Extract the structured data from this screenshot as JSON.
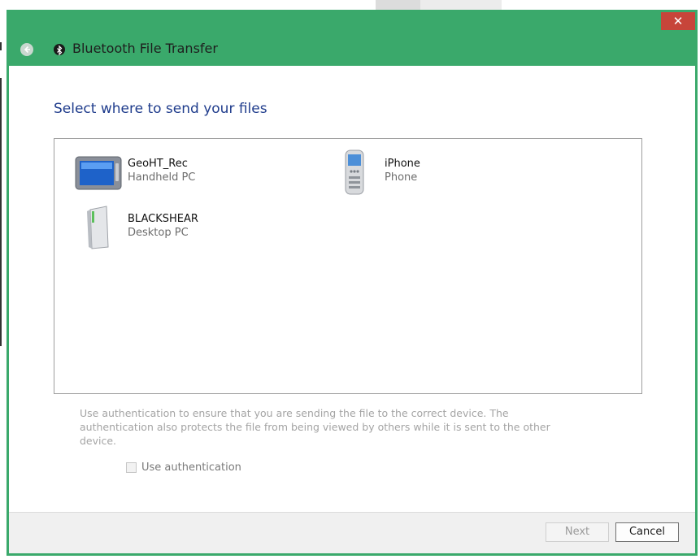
{
  "window": {
    "title": "Bluetooth File Transfer",
    "close_glyph": "✕"
  },
  "main": {
    "heading": "Select where to send your files"
  },
  "devices": [
    {
      "name": "GeoHT_Rec",
      "type": "Handheld PC",
      "icon": "handheld-pc-icon"
    },
    {
      "name": "iPhone",
      "type": "Phone",
      "icon": "phone-icon"
    },
    {
      "name": "BLACKSHEAR",
      "type": "Desktop PC",
      "icon": "desktop-pc-icon"
    }
  ],
  "auth": {
    "description": "Use authentication to ensure that you are sending the file to the correct device. The authentication also protects the file from being viewed by others while it is sent to the other device.",
    "checkbox_label": "Use authentication",
    "checked": false
  },
  "buttons": {
    "next": "Next",
    "cancel": "Cancel"
  },
  "colors": {
    "accent": "#3aa96b",
    "close": "#c7453a",
    "heading": "#1f3c8c"
  }
}
